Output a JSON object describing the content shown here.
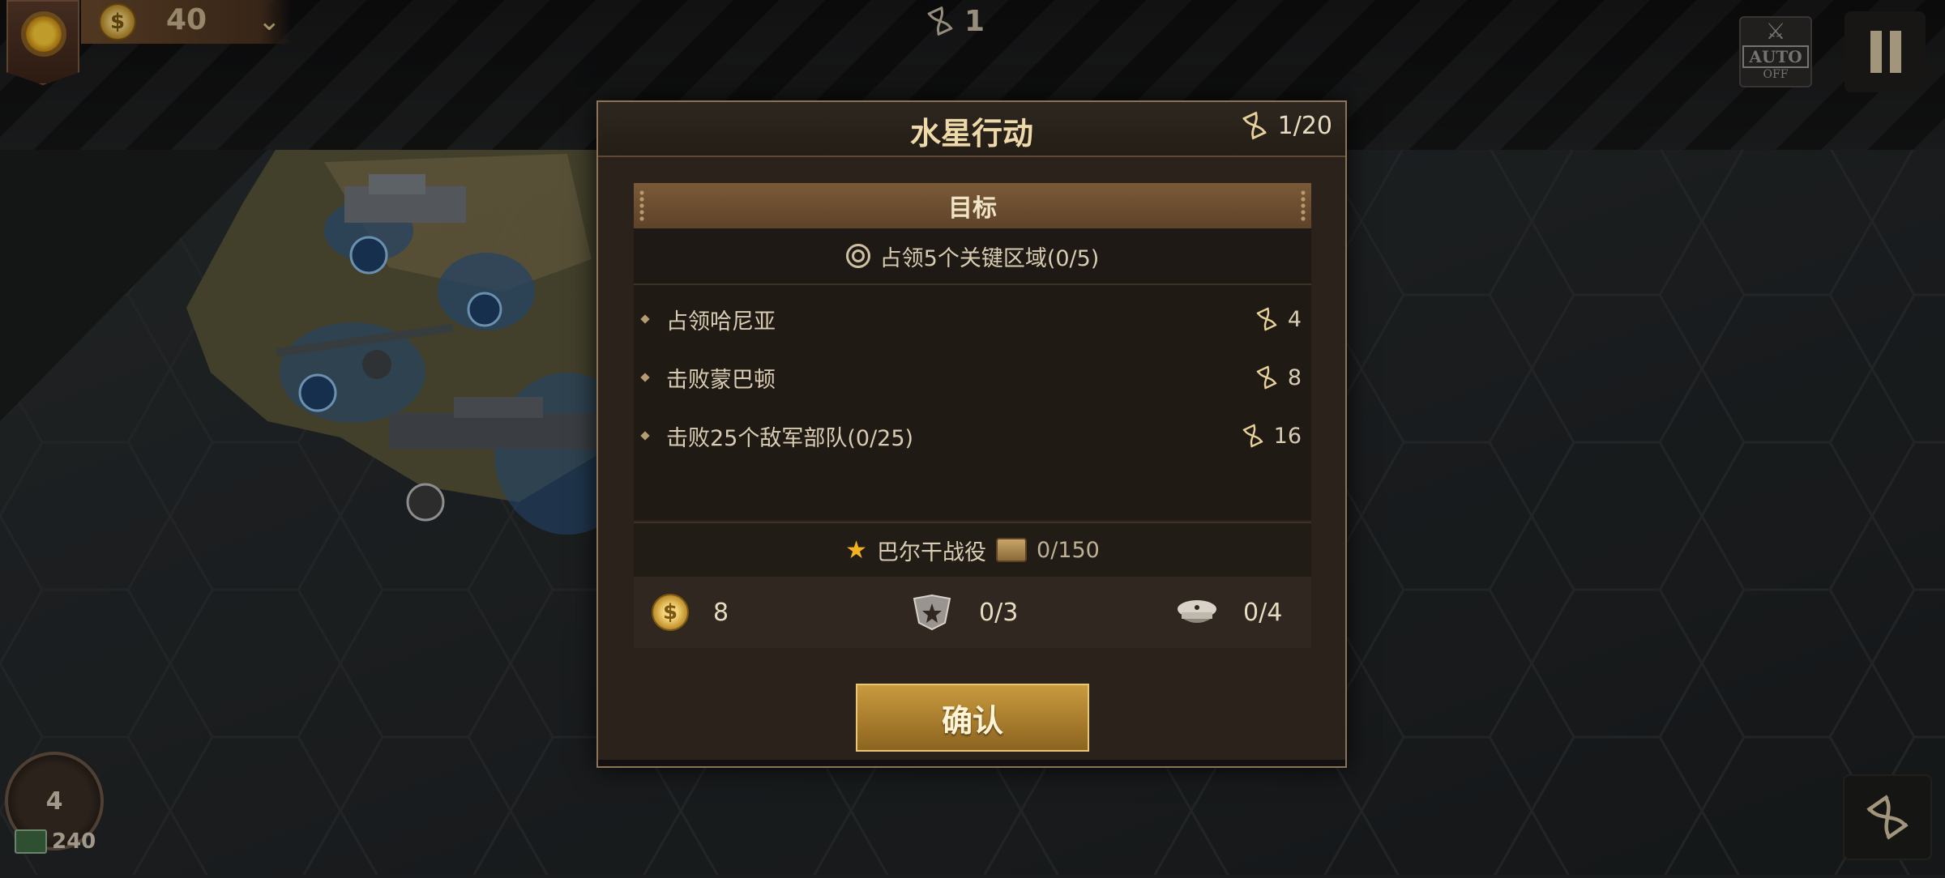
{
  "hud": {
    "coins": "40",
    "turn": "1",
    "auto_label": "AUTO",
    "auto_state": "OFF",
    "rank_level": "4",
    "cash": "240"
  },
  "dialog": {
    "title": "水星行动",
    "turns": "1/20",
    "objectives_header": "目标",
    "main_goal": "占领5个关键区域(0/5)",
    "goals": [
      {
        "label": "占领哈尼亚",
        "reward_turns": "4"
      },
      {
        "label": "击败蒙巴顿",
        "reward_turns": "8"
      },
      {
        "label": "击败25个敌军部队(0/25)",
        "reward_turns": "16"
      }
    ],
    "campaign": {
      "label": "巴尔干战役",
      "progress": "0/150"
    },
    "rewards": {
      "coins": "8",
      "medals": "0/3",
      "officers": "0/4"
    },
    "confirm_label": "确认"
  },
  "colors": {
    "accent_gold": "#c99a3e",
    "panel_bg": "#2a221b",
    "star": "#f2b11f"
  }
}
